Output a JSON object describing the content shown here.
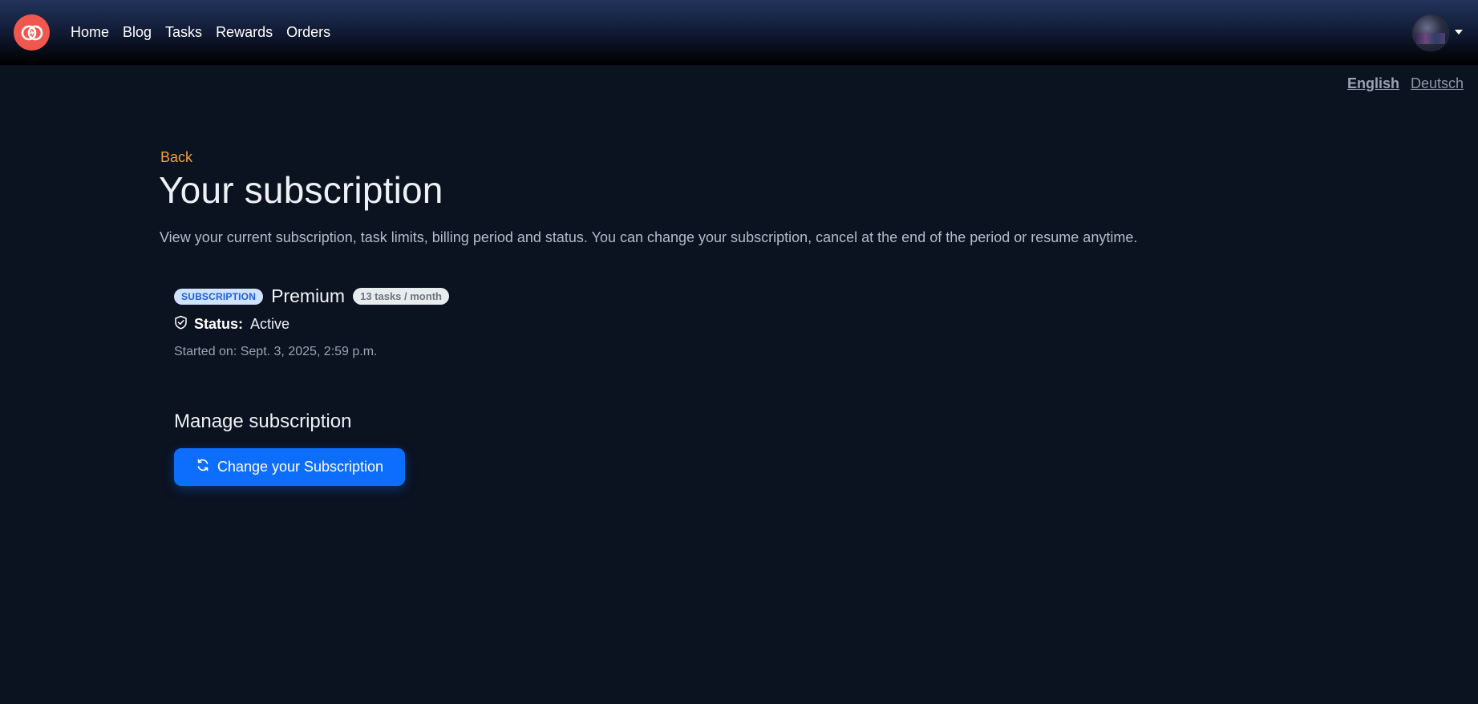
{
  "nav": {
    "items": [
      {
        "label": "Home"
      },
      {
        "label": "Blog"
      },
      {
        "label": "Tasks"
      },
      {
        "label": "Rewards"
      },
      {
        "label": "Orders"
      }
    ]
  },
  "languages": {
    "english": "English",
    "deutsch": "Deutsch",
    "active": "English"
  },
  "page": {
    "back_label": "Back",
    "title": "Your subscription",
    "description": "View your current subscription, task limits, billing period and status. You can change your subscription, cancel at the end of the period or resume anytime."
  },
  "subscription": {
    "badge": "SUBSCRIPTION",
    "plan": "Premium",
    "tasks_badge": "13 tasks / month",
    "status_label": "Status:",
    "status_value": "Active",
    "started": "Started on: Sept. 3, 2025, 2:59 p.m."
  },
  "manage": {
    "heading": "Manage subscription",
    "change_button": "Change your Subscription"
  },
  "colors": {
    "background": "#0b1220",
    "accent": "#0d6efd",
    "back_link": "#f0a13a",
    "logo": "#f0574e"
  },
  "icons": {
    "logo": "brand-logo-icon",
    "status": "shield-check-icon",
    "change": "refresh-icon",
    "dropdown": "caret-down-icon"
  }
}
